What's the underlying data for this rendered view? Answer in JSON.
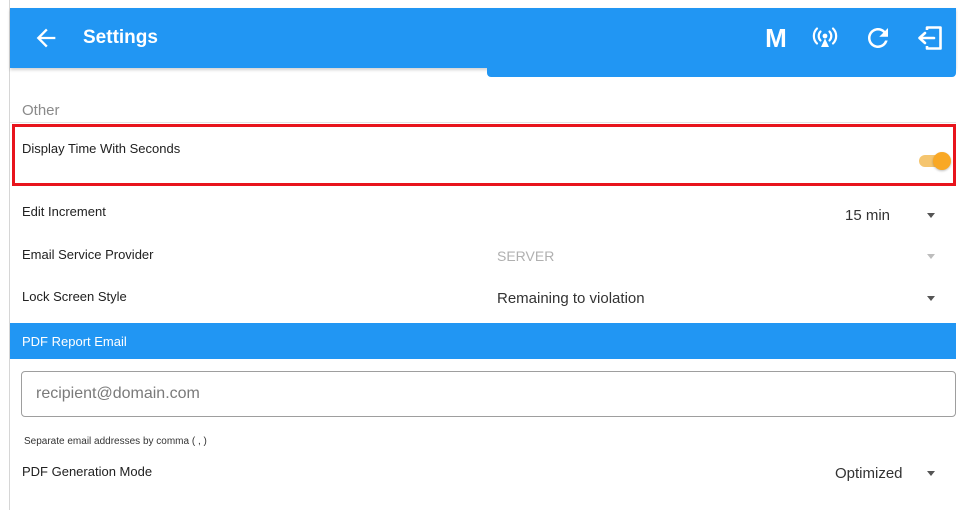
{
  "header": {
    "title": "Settings",
    "m_label": "M",
    "back_icon": "arrow-left-icon",
    "actions": [
      "wireless-signal-icon",
      "refresh-icon",
      "logout-icon"
    ]
  },
  "section_other": "Other",
  "settings": {
    "display_time_with_seconds": {
      "label": "Display Time With Seconds",
      "enabled": true
    },
    "edit_increment": {
      "label": "Edit Increment",
      "value": "15 min"
    },
    "email_service_provider": {
      "label": "Email Service Provider",
      "value": "SERVER"
    },
    "lock_screen_style": {
      "label": "Lock Screen Style",
      "value": "Remaining to violation"
    }
  },
  "pdf_report_email": {
    "header": "PDF Report Email",
    "placeholder": "recipient@domain.com",
    "hint": "Separate email addresses by comma ( , )"
  },
  "pdf_generation_mode": {
    "label": "PDF Generation Mode",
    "value": "Optimized"
  },
  "colors": {
    "primary": "#2196f3",
    "highlight_border": "#e8141c",
    "toggle_on": "#f9a825"
  }
}
